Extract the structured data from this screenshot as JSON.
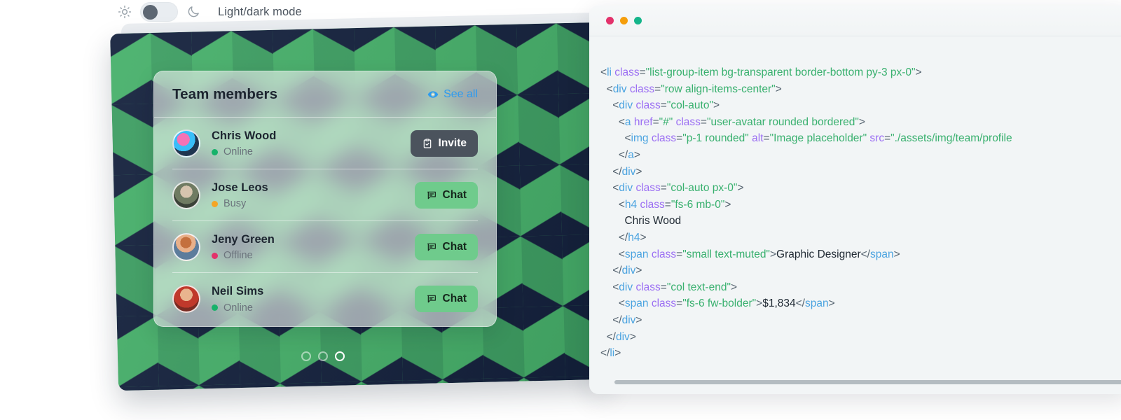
{
  "theme_toggle": {
    "label": "Light/dark mode",
    "sun_icon": "sun-icon",
    "moon_icon": "moon-icon",
    "state": "light",
    "knob_color": "#5d6773",
    "track_color": "#e9edf1"
  },
  "team_card": {
    "title": "Team members",
    "see_all_label": "See all",
    "see_all_icon": "eye-icon",
    "see_all_color": "#2d9bf0",
    "members": [
      {
        "name": "Chris Wood",
        "status": "Online",
        "status_color": "#17b26a",
        "action_label": "Invite",
        "action_icon": "clipboard-check-icon",
        "action_style": "dark"
      },
      {
        "name": "Jose Leos",
        "status": "Busy",
        "status_color": "#f5a524",
        "action_label": "Chat",
        "action_icon": "chat-bubble-icon",
        "action_style": "green"
      },
      {
        "name": "Jeny Green",
        "status": "Offline",
        "status_color": "#e3326b",
        "action_label": "Chat",
        "action_icon": "chat-bubble-icon",
        "action_style": "green"
      },
      {
        "name": "Neil Sims",
        "status": "Online",
        "status_color": "#17b26a",
        "action_label": "Chat",
        "action_icon": "chat-bubble-icon",
        "action_style": "green"
      }
    ]
  },
  "carousel": {
    "slides": 3,
    "active_index": 2
  },
  "backdrop": {
    "pattern": "isometric-cubes",
    "colors": [
      "#4fbd74",
      "#3d9e62",
      "#14213d"
    ]
  },
  "code_window": {
    "traffic_lights": [
      {
        "name": "close",
        "color": "#e3326b"
      },
      {
        "name": "minimize",
        "color": "#f59e0b"
      },
      {
        "name": "maximize",
        "color": "#14b58a"
      }
    ],
    "language": "html",
    "scrollbar": {
      "orientation": "horizontal",
      "position": "left"
    },
    "lines": [
      [
        {
          "t": "pun",
          "s": "<"
        },
        {
          "t": "tag",
          "s": "li"
        },
        {
          "t": "txt",
          "s": " "
        },
        {
          "t": "attr",
          "s": "class"
        },
        {
          "t": "pun",
          "s": "="
        },
        {
          "t": "val",
          "s": "\"list-group-item bg-transparent border-bottom py-3 px-0\""
        },
        {
          "t": "pun",
          "s": ">"
        }
      ],
      [
        {
          "t": "txt",
          "s": "  "
        },
        {
          "t": "pun",
          "s": "<"
        },
        {
          "t": "tag",
          "s": "div"
        },
        {
          "t": "txt",
          "s": " "
        },
        {
          "t": "attr",
          "s": "class"
        },
        {
          "t": "pun",
          "s": "="
        },
        {
          "t": "val",
          "s": "\"row align-items-center\""
        },
        {
          "t": "pun",
          "s": ">"
        }
      ],
      [
        {
          "t": "txt",
          "s": "    "
        },
        {
          "t": "pun",
          "s": "<"
        },
        {
          "t": "tag",
          "s": "div"
        },
        {
          "t": "txt",
          "s": " "
        },
        {
          "t": "attr",
          "s": "class"
        },
        {
          "t": "pun",
          "s": "="
        },
        {
          "t": "val",
          "s": "\"col-auto\""
        },
        {
          "t": "pun",
          "s": ">"
        }
      ],
      [
        {
          "t": "txt",
          "s": "      "
        },
        {
          "t": "pun",
          "s": "<"
        },
        {
          "t": "tag",
          "s": "a"
        },
        {
          "t": "txt",
          "s": " "
        },
        {
          "t": "attr",
          "s": "href"
        },
        {
          "t": "pun",
          "s": "="
        },
        {
          "t": "val",
          "s": "\"#\""
        },
        {
          "t": "txt",
          "s": " "
        },
        {
          "t": "attr",
          "s": "class"
        },
        {
          "t": "pun",
          "s": "="
        },
        {
          "t": "val",
          "s": "\"user-avatar rounded bordered\""
        },
        {
          "t": "pun",
          "s": ">"
        }
      ],
      [
        {
          "t": "txt",
          "s": "        "
        },
        {
          "t": "pun",
          "s": "<"
        },
        {
          "t": "tag",
          "s": "img"
        },
        {
          "t": "txt",
          "s": " "
        },
        {
          "t": "attr",
          "s": "class"
        },
        {
          "t": "pun",
          "s": "="
        },
        {
          "t": "val",
          "s": "\"p-1 rounded\""
        },
        {
          "t": "txt",
          "s": " "
        },
        {
          "t": "attr",
          "s": "alt"
        },
        {
          "t": "pun",
          "s": "="
        },
        {
          "t": "val",
          "s": "\"Image placeholder\""
        },
        {
          "t": "txt",
          "s": " "
        },
        {
          "t": "attr",
          "s": "src"
        },
        {
          "t": "pun",
          "s": "="
        },
        {
          "t": "val",
          "s": "\"./assets/img/team/profile"
        }
      ],
      [
        {
          "t": "txt",
          "s": "      "
        },
        {
          "t": "pun",
          "s": "</"
        },
        {
          "t": "tag",
          "s": "a"
        },
        {
          "t": "pun",
          "s": ">"
        }
      ],
      [
        {
          "t": "txt",
          "s": "    "
        },
        {
          "t": "pun",
          "s": "</"
        },
        {
          "t": "tag",
          "s": "div"
        },
        {
          "t": "pun",
          "s": ">"
        }
      ],
      [
        {
          "t": "txt",
          "s": "    "
        },
        {
          "t": "pun",
          "s": "<"
        },
        {
          "t": "tag",
          "s": "div"
        },
        {
          "t": "txt",
          "s": " "
        },
        {
          "t": "attr",
          "s": "class"
        },
        {
          "t": "pun",
          "s": "="
        },
        {
          "t": "val",
          "s": "\"col-auto px-0\""
        },
        {
          "t": "pun",
          "s": ">"
        }
      ],
      [
        {
          "t": "txt",
          "s": "      "
        },
        {
          "t": "pun",
          "s": "<"
        },
        {
          "t": "tag",
          "s": "h4"
        },
        {
          "t": "txt",
          "s": " "
        },
        {
          "t": "attr",
          "s": "class"
        },
        {
          "t": "pun",
          "s": "="
        },
        {
          "t": "val",
          "s": "\"fs-6 mb-0\""
        },
        {
          "t": "pun",
          "s": ">"
        }
      ],
      [
        {
          "t": "txt",
          "s": "        Chris Wood"
        }
      ],
      [
        {
          "t": "txt",
          "s": "      "
        },
        {
          "t": "pun",
          "s": "</"
        },
        {
          "t": "tag",
          "s": "h4"
        },
        {
          "t": "pun",
          "s": ">"
        }
      ],
      [
        {
          "t": "txt",
          "s": "      "
        },
        {
          "t": "pun",
          "s": "<"
        },
        {
          "t": "tag",
          "s": "span"
        },
        {
          "t": "txt",
          "s": " "
        },
        {
          "t": "attr",
          "s": "class"
        },
        {
          "t": "pun",
          "s": "="
        },
        {
          "t": "val",
          "s": "\"small text-muted\""
        },
        {
          "t": "pun",
          "s": ">"
        },
        {
          "t": "txt",
          "s": "Graphic Designer"
        },
        {
          "t": "pun",
          "s": "</"
        },
        {
          "t": "tag",
          "s": "span"
        },
        {
          "t": "pun",
          "s": ">"
        }
      ],
      [
        {
          "t": "txt",
          "s": "    "
        },
        {
          "t": "pun",
          "s": "</"
        },
        {
          "t": "tag",
          "s": "div"
        },
        {
          "t": "pun",
          "s": ">"
        }
      ],
      [
        {
          "t": "txt",
          "s": "    "
        },
        {
          "t": "pun",
          "s": "<"
        },
        {
          "t": "tag",
          "s": "div"
        },
        {
          "t": "txt",
          "s": " "
        },
        {
          "t": "attr",
          "s": "class"
        },
        {
          "t": "pun",
          "s": "="
        },
        {
          "t": "val",
          "s": "\"col text-end\""
        },
        {
          "t": "pun",
          "s": ">"
        }
      ],
      [
        {
          "t": "txt",
          "s": "      "
        },
        {
          "t": "pun",
          "s": "<"
        },
        {
          "t": "tag",
          "s": "span"
        },
        {
          "t": "txt",
          "s": " "
        },
        {
          "t": "attr",
          "s": "class"
        },
        {
          "t": "pun",
          "s": "="
        },
        {
          "t": "val",
          "s": "\"fs-6 fw-bolder\""
        },
        {
          "t": "pun",
          "s": ">"
        },
        {
          "t": "txt",
          "s": "$1,834"
        },
        {
          "t": "pun",
          "s": "</"
        },
        {
          "t": "tag",
          "s": "span"
        },
        {
          "t": "pun",
          "s": ">"
        }
      ],
      [
        {
          "t": "txt",
          "s": "    "
        },
        {
          "t": "pun",
          "s": "</"
        },
        {
          "t": "tag",
          "s": "div"
        },
        {
          "t": "pun",
          "s": ">"
        }
      ],
      [
        {
          "t": "txt",
          "s": "  "
        },
        {
          "t": "pun",
          "s": "</"
        },
        {
          "t": "tag",
          "s": "div"
        },
        {
          "t": "pun",
          "s": ">"
        }
      ],
      [
        {
          "t": "pun",
          "s": "</"
        },
        {
          "t": "tag",
          "s": "li"
        },
        {
          "t": "pun",
          "s": ">"
        }
      ]
    ]
  }
}
